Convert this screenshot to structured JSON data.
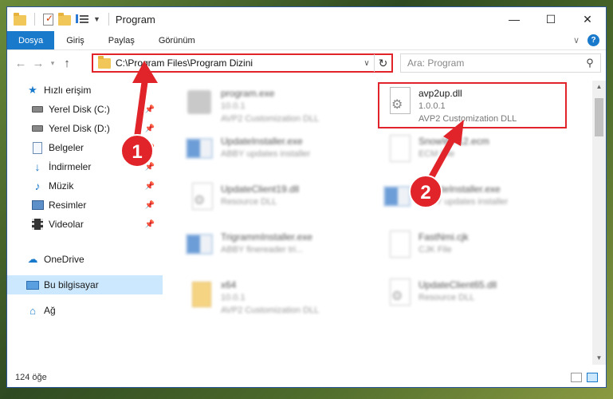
{
  "window": {
    "title": "Program",
    "controls": {
      "minimize": "—",
      "maximize": "☐",
      "close": "✕"
    }
  },
  "ribbon": {
    "tabs": [
      "Dosya",
      "Giriş",
      "Paylaş",
      "Görünüm"
    ],
    "accent": "#1979ca"
  },
  "navbar": {
    "back": "←",
    "forward": "→",
    "recent": "▾",
    "up": "↑",
    "address": "C:\\Program Files\\Program Dizini",
    "address_dropdown": "∨",
    "refresh": "↻",
    "search_placeholder": "Ara: Program",
    "search_icon": "search-icon"
  },
  "sidebar": {
    "items": [
      {
        "label": "Hızlı erişim",
        "icon": "star-icon"
      },
      {
        "label": "Yerel Disk (C:)",
        "icon": "disk-icon",
        "pinned": true
      },
      {
        "label": "Yerel Disk (D:)",
        "icon": "disk-icon",
        "pinned": true
      },
      {
        "label": "Belgeler",
        "icon": "documents-icon",
        "pinned": true
      },
      {
        "label": "İndirmeler",
        "icon": "download-icon",
        "pinned": true
      },
      {
        "label": "Müzik",
        "icon": "music-icon",
        "pinned": true
      },
      {
        "label": "Resimler",
        "icon": "pictures-icon",
        "pinned": true
      },
      {
        "label": "Videolar",
        "icon": "videos-icon",
        "pinned": true
      },
      {
        "label": "OneDrive",
        "icon": "cloud-icon"
      },
      {
        "label": "Bu bilgisayar",
        "icon": "computer-icon",
        "selected": true
      },
      {
        "label": "Ağ",
        "icon": "network-icon"
      }
    ]
  },
  "files": [
    {
      "name": "program.exe",
      "line1": "10.0.1",
      "line2": "AVP2 Customization DLL",
      "icon": "exe-icon"
    },
    {
      "name": "avp2up.dll",
      "line1": "1.0.0.1",
      "line2": "AVP2 Customization DLL",
      "icon": "dll-icon",
      "highlighted": true
    },
    {
      "name": "UpdateInstaller.exe",
      "line1": "ABBY updates installer",
      "line2": "",
      "icon": "installer-icon"
    },
    {
      "name": "SnowWP12.ecm",
      "line1": "ECM File",
      "line2": "",
      "icon": "file-icon"
    },
    {
      "name": "UpdateClient19.dll",
      "line1": "Resource DLL",
      "line2": "",
      "icon": "dll-icon"
    },
    {
      "name": "UpdateInstaller.exe",
      "line1": "ABBY updates installer",
      "line2": "",
      "icon": "installer-icon"
    },
    {
      "name": "TrigrammInstaller.exe",
      "line1": "ABBY finereader tri...",
      "line2": "",
      "icon": "installer-icon"
    },
    {
      "name": "FastNmi.cjk",
      "line1": "CJK File",
      "line2": "",
      "icon": "file-icon"
    },
    {
      "name": "x64",
      "line1": "10.0.1",
      "line2": "AVP2 Customization DLL",
      "icon": "folder-icon"
    },
    {
      "name": "UpdateClient65.dll",
      "line1": "Resource DLL",
      "line2": "",
      "icon": "dll-icon"
    }
  ],
  "status": {
    "item_count": "124 öğe"
  },
  "annotations": {
    "step1": "1",
    "step2": "2",
    "highlight_color": "#e0242a"
  }
}
